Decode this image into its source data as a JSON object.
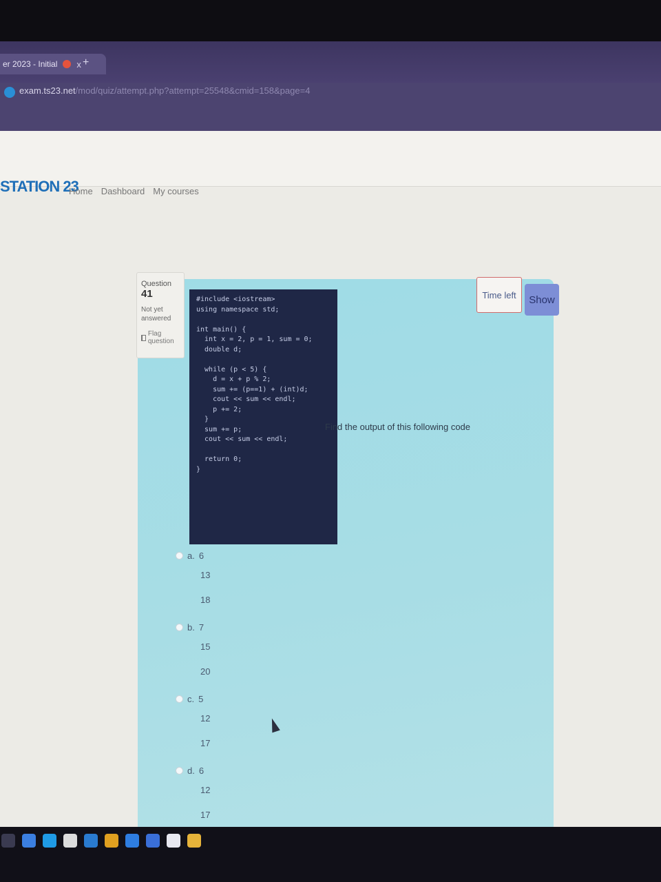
{
  "browser": {
    "tab_title": "er 2023 - Initial",
    "tab_close": "x",
    "new_tab": "+",
    "url_host": "exam.ts23.net",
    "url_path": "/mod/quiz/attempt.php?attempt=25548&cmid=158&page=4"
  },
  "site": {
    "brand": "STATION 23",
    "nav": [
      "Home",
      "Dashboard",
      "My courses"
    ]
  },
  "question_info": {
    "label": "Question",
    "number": "41",
    "status": "Not yet answered",
    "flag": "Flag question"
  },
  "timer": {
    "label": "Time left",
    "button": "Show"
  },
  "question": {
    "code_lines": [
      "#include <iostream>",
      "using namespace std;",
      "",
      "int main() {",
      "  int x = 2, p = 1, sum = 0;",
      "  double d;",
      "",
      "  while (p < 5) {",
      "    d = x + p % 2;",
      "    sum += (p==1) + (int)d;",
      "    cout << sum << endl;",
      "    p += 2;",
      "  }",
      "  sum += p;",
      "  cout << sum << endl;",
      "",
      "  return 0;",
      "}"
    ],
    "prompt": "Find the output of this following code",
    "options": [
      {
        "letter": "a.",
        "lines": [
          "6",
          "13",
          "18"
        ]
      },
      {
        "letter": "b.",
        "lines": [
          "7",
          "15",
          "20"
        ]
      },
      {
        "letter": "c.",
        "lines": [
          "5",
          "12",
          "17"
        ]
      },
      {
        "letter": "d.",
        "lines": [
          "6",
          "12",
          "17"
        ]
      }
    ]
  },
  "colors": {
    "panel": "#a8dde5",
    "code_bg": "#1f2746",
    "brand": "#1f6fb8",
    "show_button": "#7d8ed6"
  }
}
